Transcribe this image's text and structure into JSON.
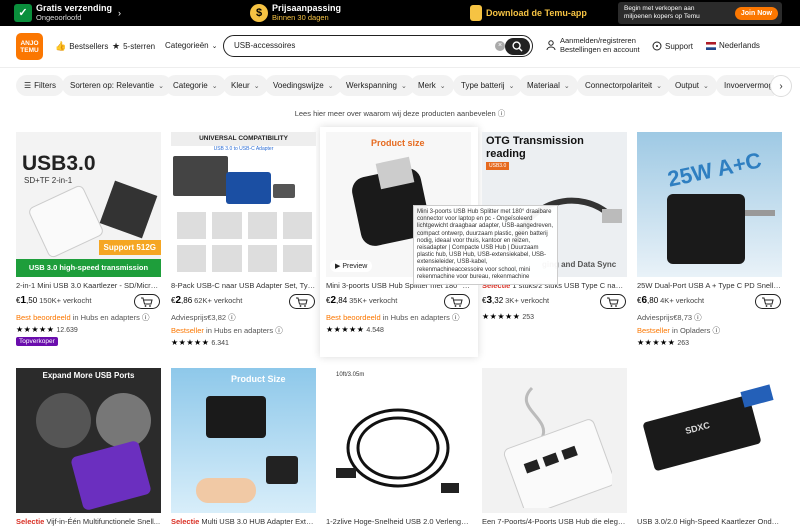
{
  "topbar": {
    "shipping_title": "Gratis verzending",
    "shipping_sub": "Ongeoorloofd",
    "price_title": "Prijsaanpassing",
    "price_sub": "Binnen 30 dagen",
    "app_label": "Download de Temu-app",
    "promo_text": "Begin met verkopen aan miljoenen kopers op Temu",
    "promo_button": "Join Now"
  },
  "header": {
    "logo_line1": "ANJO",
    "logo_line2": "TEMU",
    "bestsellers": "Bestsellers",
    "five_stars": "5-sterren",
    "categories": "Categorieën",
    "search_value": "USB-accessoires",
    "account_line1": "Aanmelden/registreren",
    "account_line2": "Bestellingen en account",
    "support": "Support",
    "language": "Nederlands"
  },
  "filters": [
    "Filters",
    "Sorteren op: Relevantie",
    "Categorie",
    "Kleur",
    "Voedingswijze",
    "Werkspanning",
    "Merk",
    "Type batterij",
    "Materiaal",
    "Connectorpolariteit",
    "Output",
    "Invoervermog"
  ],
  "learn_more": "Lees hier meer over waarom wij deze producten aanbevelen",
  "products": [
    {
      "title": "2-in-1 Mini USB 3.0 Kaartlezer - SD/Micro SD",
      "selectie": "",
      "price_main": "1",
      "price_dec": ",50",
      "sold": "150K+ verkocht",
      "line3_a": "Best beoordeeld",
      "line3_b": "in Hubs en adapters",
      "stars": "★★★★★",
      "reviews": "12.639",
      "badge": "Topverkoper",
      "img_text1": "USB3.0",
      "img_text2": "SD+TF 2-in-1",
      "img_banner": "USB 3.0 high-speed transmission",
      "img_support": "Support 512G"
    },
    {
      "title": "8-Pack USB-C naar USB Adapter Set, Type-C",
      "selectie": "",
      "price_main": "2",
      "price_dec": ",86",
      "sold": "62K+ verkocht",
      "line3_a": "Adviesprijs",
      "line3_b": "€3,82",
      "stars": "★★★★★",
      "reviews": "",
      "badge": "",
      "line4_a": "Bestseller",
      "line4_b": "in Hubs en adapters",
      "reviews2": "6.341",
      "img_text1": "UNIVERSAL COMPATIBILITY",
      "img_text2": "USB 3.0 to USB-C Adapter"
    },
    {
      "title": "Mini 3-poorts USB Hub Splitter met 180° d...",
      "selectie": "",
      "price_main": "2",
      "price_dec": ",84",
      "sold": "35K+ verkocht",
      "line3_a": "Best beoordeeld",
      "line3_b": "in Hubs en adapters",
      "stars": "★★★★★",
      "reviews": "4.548",
      "badge": "",
      "img_text1": "Product size",
      "preview": "Preview"
    },
    {
      "title": "1 stuks/2 stuks USB Type C naar ...",
      "selectie": "Selectie",
      "price_main": "3",
      "price_dec": ",32",
      "sold": "3K+ verkocht",
      "line3_a": "",
      "line3_b": "",
      "stars": "★★★★★",
      "reviews": "253",
      "badge": "",
      "img_text1": "OTG Transmission",
      "img_text2": "reading",
      "img_text3": "ging and Data Sync"
    },
    {
      "title": "25W Dual-Port USB A + Type C PD Snelle Ez...",
      "selectie": "",
      "price_main": "6",
      "price_dec": ",80",
      "sold": "4K+ verkocht",
      "line3_a": "Adviesprijs",
      "line3_b": "€8,73",
      "stars": "★★★★★",
      "reviews": "",
      "badge": "",
      "line4_a": "Bestseller",
      "line4_b": "in Opladers",
      "reviews2": "263",
      "img_text1": "25W A+C"
    }
  ],
  "products_row2": [
    {
      "title": "Vijf-in-Één Multifunctionele Snell...",
      "selectie": "Selectie",
      "img_text": "Expand More USB Ports"
    },
    {
      "title": "Multi USB 3.0 HUB Adapter Exten...",
      "selectie": "Selectie",
      "img_text": "Product Size"
    },
    {
      "title": "1-2zlive Hoge-Snelheid USB 2.0 Verlengkab...",
      "selectie": "",
      "img_text": "10ft/3.05m"
    },
    {
      "title": "Een 7-Poorts/4-Poorts USB Hub die elegan...",
      "selectie": "",
      "img_text": ""
    },
    {
      "title": "USB 3.0/2.0 High-Speed Kaartlezer Onders...",
      "selectie": "",
      "img_text": "SDXC"
    }
  ],
  "tooltip": "Mini 3-poorts USB Hub Splitter met 180° draaibare connector voor laptop en pc - Ongeïsoleerd lichtgewicht draagbaar adapter, USB-aangedreven, compact ontwerp, duurzaam plastic, geen batterij nodig, ideaal voor thuis, kantoor en reizen, reisadapter | Compacte USB Hub | Duurzaam plastic hub, USB Hub, USB-extensiekabel, USB-extensieleider, USB-kabel, rekenmachineaccessoire voor school, mini rekenmachine voor bureau, rekenmachine",
  "currency": "€"
}
